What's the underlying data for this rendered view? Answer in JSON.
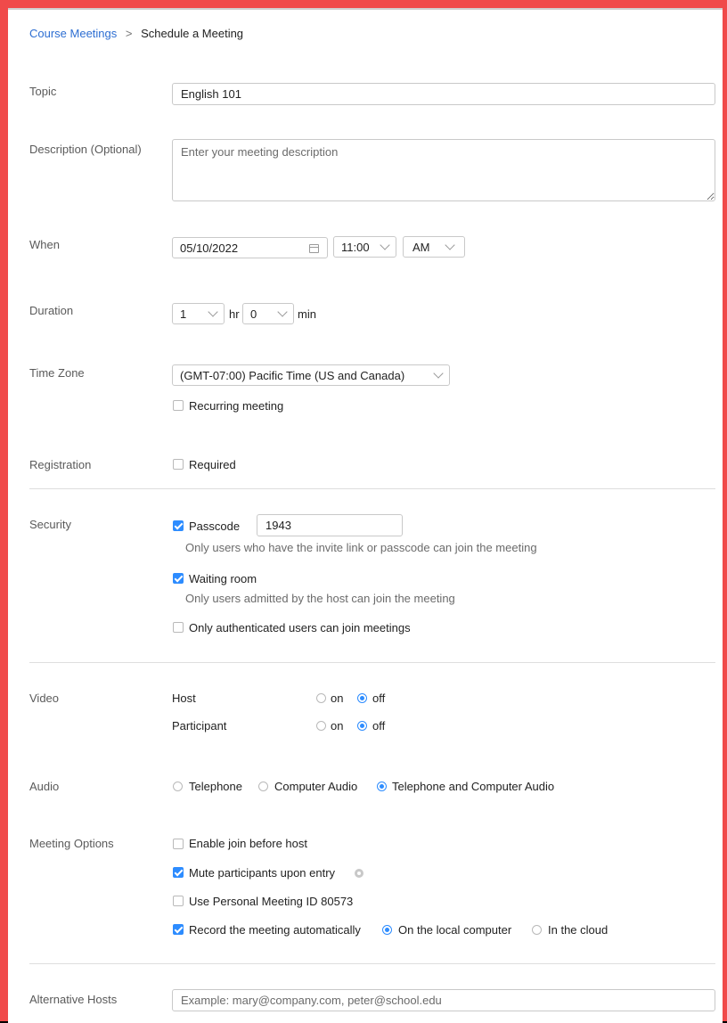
{
  "breadcrumb": {
    "parent": "Course Meetings",
    "separator": ">",
    "current": "Schedule a Meeting"
  },
  "topic": {
    "label": "Topic",
    "value": "English 101"
  },
  "description": {
    "label": "Description (Optional)",
    "placeholder": "Enter your meeting description"
  },
  "when": {
    "label": "When",
    "date": "05/10/2022",
    "time": "11:00",
    "ampm": "AM"
  },
  "duration": {
    "label": "Duration",
    "hours": "1",
    "hr_unit": "hr",
    "minutes": "0",
    "min_unit": "min"
  },
  "timezone": {
    "label": "Time Zone",
    "value": "(GMT-07:00) Pacific Time (US and Canada)",
    "recurring_label": "Recurring meeting",
    "recurring_checked": false
  },
  "registration": {
    "label": "Registration",
    "required_label": "Required",
    "required_checked": false
  },
  "security": {
    "label": "Security",
    "passcode_label": "Passcode",
    "passcode_checked": true,
    "passcode_value": "1943",
    "passcode_hint": "Only users who have the invite link or passcode can join the meeting",
    "waiting_label": "Waiting room",
    "waiting_checked": true,
    "waiting_hint": "Only users admitted by the host can join the meeting",
    "auth_label": "Only authenticated users can join meetings",
    "auth_checked": false
  },
  "video": {
    "label": "Video",
    "host_label": "Host",
    "participant_label": "Participant",
    "on_label": "on",
    "off_label": "off",
    "host_value": "off",
    "participant_value": "off"
  },
  "audio": {
    "label": "Audio",
    "options": [
      "Telephone",
      "Computer Audio",
      "Telephone and Computer Audio"
    ],
    "selected": "Telephone and Computer Audio"
  },
  "meeting_options": {
    "label": "Meeting Options",
    "join_before_host": "Enable join before host",
    "join_before_host_checked": false,
    "mute_on_entry": "Mute participants upon entry",
    "mute_on_entry_checked": true,
    "personal_id": "Use Personal Meeting ID 80573",
    "personal_id_checked": false,
    "record_auto": "Record the meeting automatically",
    "record_auto_checked": true,
    "record_local": "On the local computer",
    "record_cloud": "In the cloud",
    "record_selected": "local"
  },
  "alt_hosts": {
    "label": "Alternative Hosts",
    "placeholder": "Example: mary@company.com, peter@school.edu"
  },
  "colors": {
    "accent": "#2d8cff",
    "frame": "#f04a4a",
    "link": "#2d6ed2"
  },
  "icons": {
    "calendar": "calendar-icon",
    "chevron": "chevron-down-icon",
    "info": "gear-icon"
  }
}
